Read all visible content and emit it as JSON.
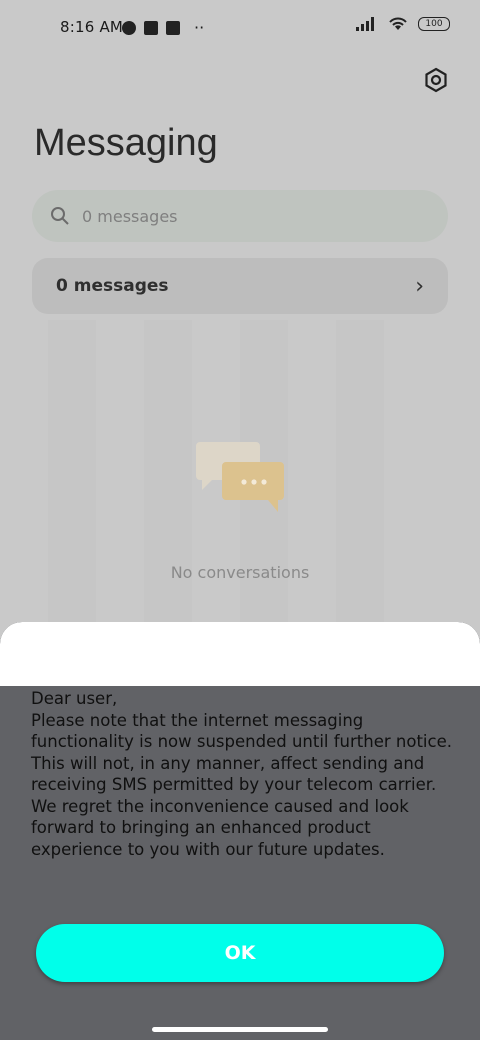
{
  "status_bar": {
    "time": "8:16 AM",
    "battery": "100"
  },
  "header": {
    "title": "Messaging"
  },
  "search": {
    "placeholder": "0 messages"
  },
  "messages_card": {
    "label": "0 messages"
  },
  "empty_state": {
    "text": "No conversations"
  },
  "dialog": {
    "text": "Dear user,\nPlease note that the internet messaging functionality is now suspended until further notice. This will not, in any manner, affect sending and receiving SMS permitted by your telecom carrier. We regret the inconvenience caused and look forward to bringing an enhanced product experience to you with our future updates.",
    "ok_label": "OK"
  },
  "colors": {
    "ok_button": "#00ffea",
    "dialog_bg": "#616266",
    "app_bg": "#c9c9c9"
  }
}
